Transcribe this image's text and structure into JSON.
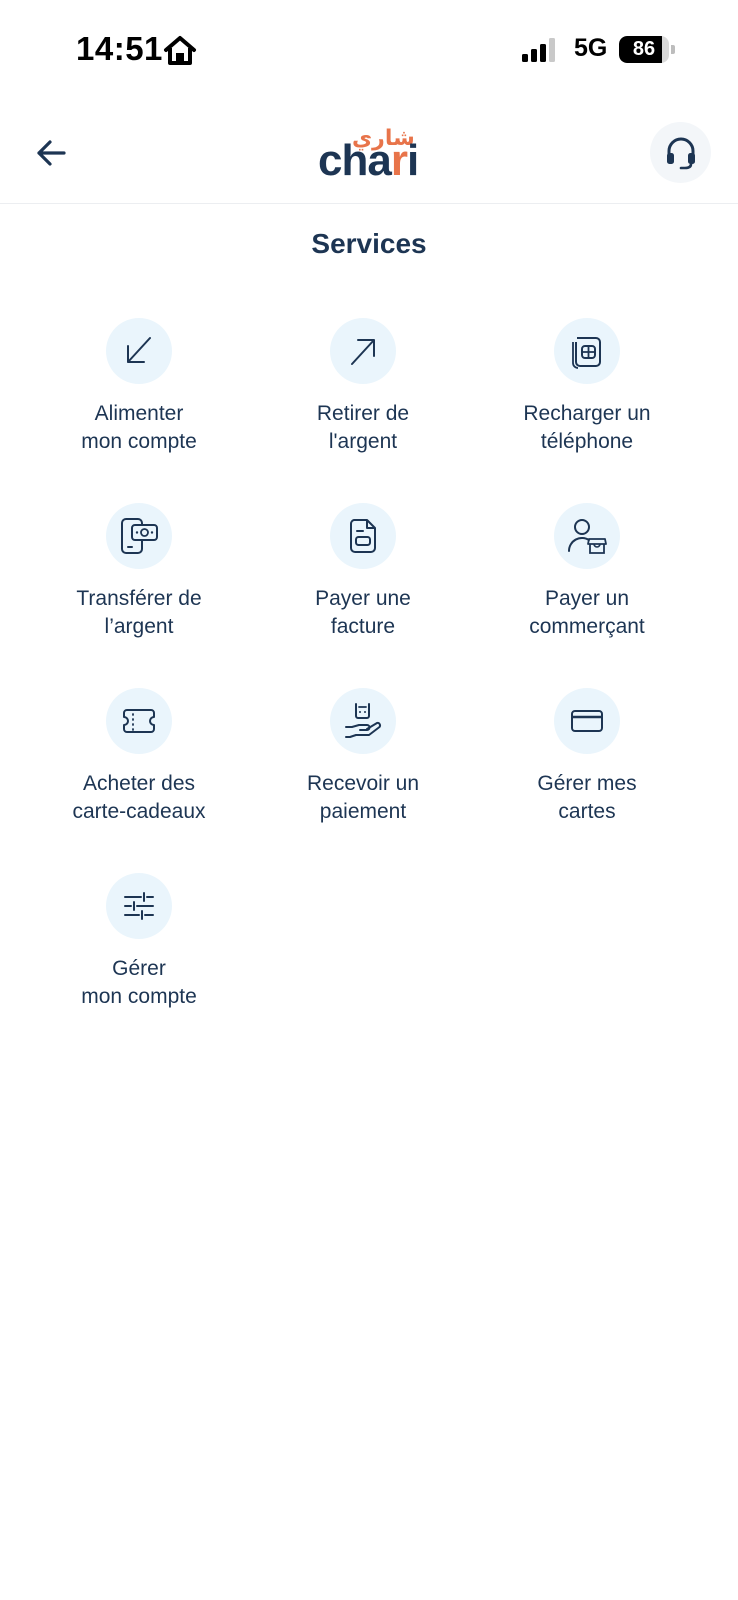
{
  "status_bar": {
    "time": "14:51",
    "network": "5G",
    "battery": "86",
    "battery_level": 0.86
  },
  "header": {
    "logo_arabic": "شاري",
    "logo_latin_main": "cha",
    "logo_latin_r": "r",
    "logo_latin_i": "i",
    "back_icon": "arrow-left-icon",
    "support_icon": "headset-icon"
  },
  "page_title": "Services",
  "services": [
    {
      "line1": "Alimenter",
      "line2": "mon compte",
      "icon": "arrow-down-left-icon"
    },
    {
      "line1": "Retirer de",
      "line2": "l'argent",
      "icon": "arrow-up-right-icon"
    },
    {
      "line1": "Recharger un",
      "line2": "téléphone",
      "icon": "sim-card-icon"
    },
    {
      "line1": "Transférer de",
      "line2": "l’argent",
      "icon": "phone-money-icon"
    },
    {
      "line1": "Payer une",
      "line2": "facture",
      "icon": "invoice-icon"
    },
    {
      "line1": "Payer un",
      "line2": "commerçant",
      "icon": "merchant-icon"
    },
    {
      "line1": "Acheter des",
      "line2": "carte-cadeaux",
      "icon": "gift-card-icon"
    },
    {
      "line1": "Recevoir un",
      "line2": "paiement",
      "icon": "receive-payment-icon"
    },
    {
      "line1": "Gérer mes",
      "line2": "cartes",
      "icon": "credit-card-icon"
    },
    {
      "line1": "Gérer",
      "line2": "mon compte",
      "icon": "settings-sliders-icon"
    }
  ],
  "colors": {
    "primary": "#1d3553",
    "accent": "#e8744a",
    "icon_bg": "#eaf5fc"
  }
}
